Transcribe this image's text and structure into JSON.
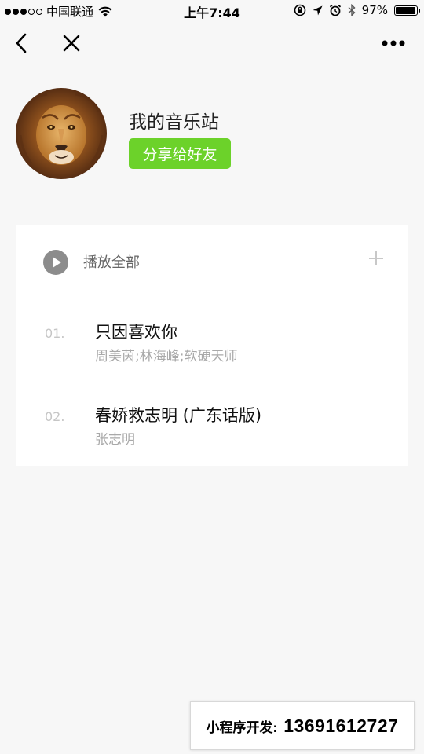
{
  "status_bar": {
    "carrier": "中国联通",
    "time": "上午7:44",
    "battery": "97%",
    "battery_level": 0.97,
    "icons": [
      "signal-dots",
      "wifi-icon",
      "rotation-lock-icon",
      "location-arrow-icon",
      "alarm-icon",
      "bluetooth-icon",
      "battery-icon"
    ]
  },
  "nav": {
    "icons": [
      "back-chevron-icon",
      "close-icon",
      "more-icon"
    ]
  },
  "profile": {
    "title": "我的音乐站",
    "share_label": "分享给好友",
    "avatar": "lion-avatar"
  },
  "playlist": {
    "play_all_label": "播放全部",
    "songs": [
      {
        "index": "01.",
        "title": "只因喜欢你",
        "artist": "周美茵;林海峰;软硬天师"
      },
      {
        "index": "02.",
        "title": "春娇救志明 (广东话版)",
        "artist": "张志明"
      }
    ]
  },
  "watermark": {
    "label": "小程序开发:",
    "number": "13691612727"
  },
  "colors": {
    "accent": "#6cd22a",
    "background": "#f7f7f7",
    "card": "#ffffff"
  }
}
